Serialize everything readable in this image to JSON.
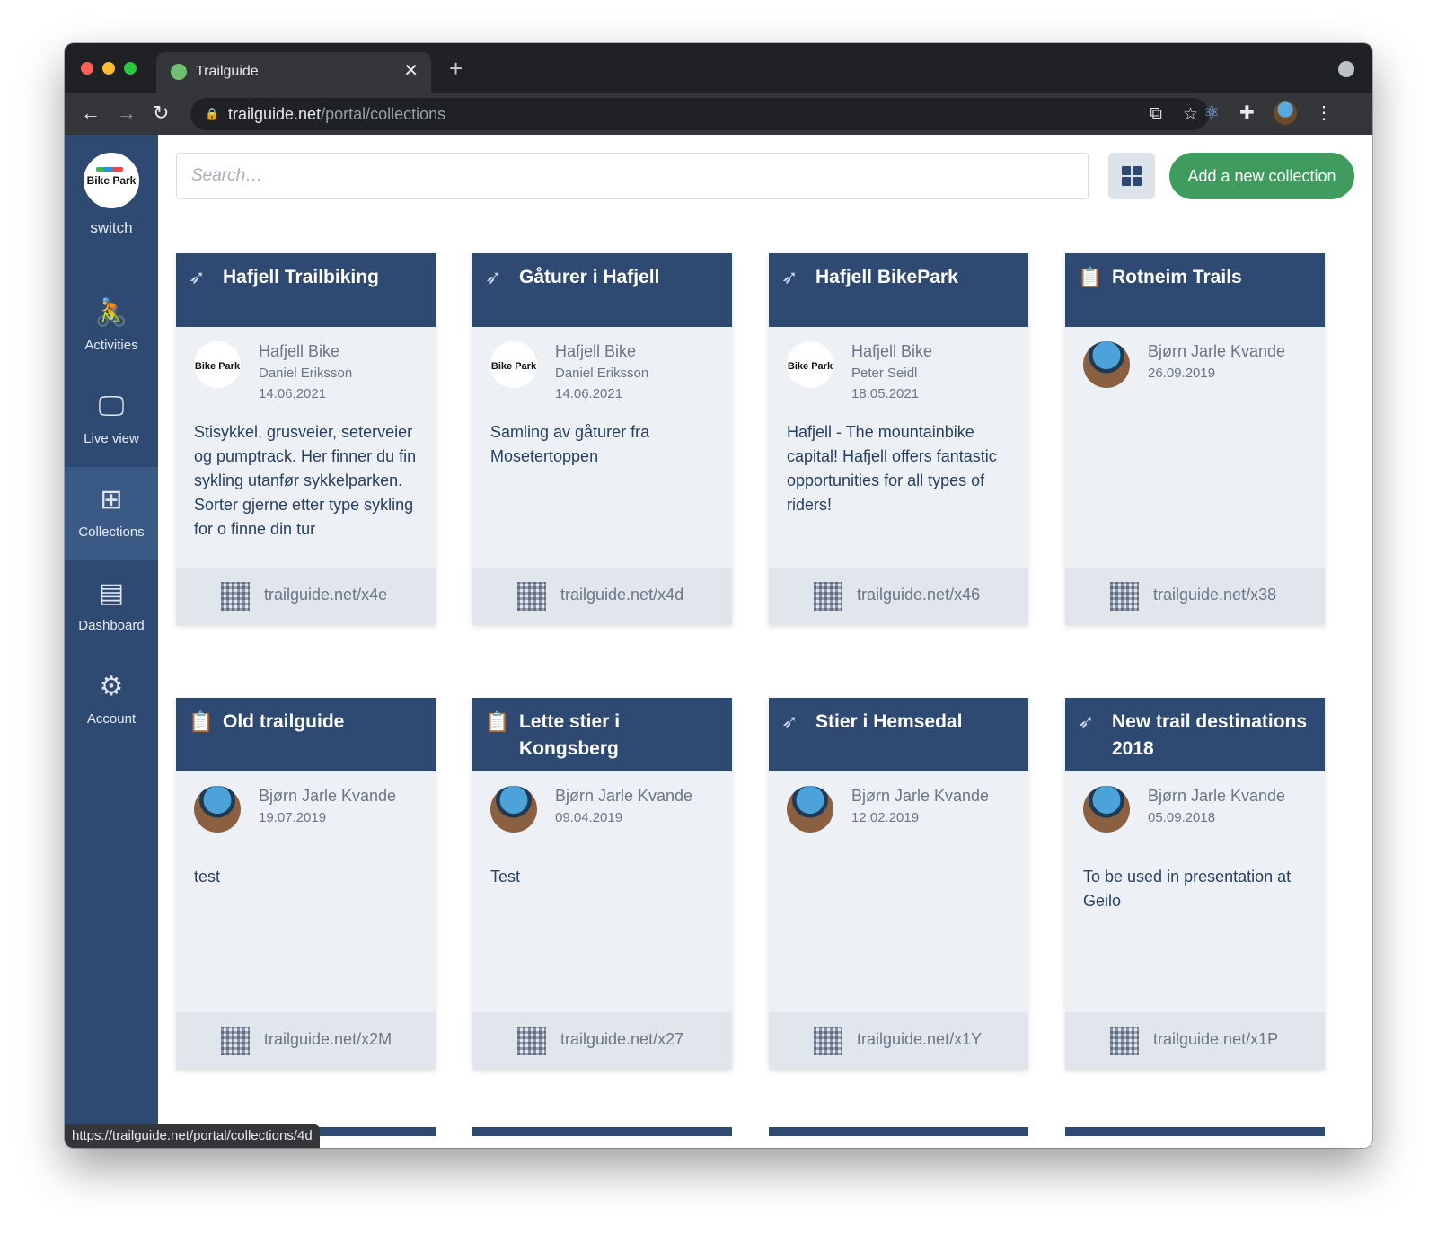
{
  "browser": {
    "tab_title": "Trailguide",
    "url_host": "trailguide.net",
    "url_path": "/portal/collections",
    "status_url": "https://trailguide.net/portal/collections/4d"
  },
  "sidebar": {
    "org_logo_text": "Bike Park",
    "switch_label": "switch",
    "items": [
      {
        "label": "Activities",
        "icon": "cyclist-icon"
      },
      {
        "label": "Live view",
        "icon": "monitor-eye-icon"
      },
      {
        "label": "Collections",
        "icon": "collections-grid-plus-icon",
        "active": true
      },
      {
        "label": "Dashboard",
        "icon": "dashboard-icon"
      },
      {
        "label": "Account",
        "icon": "gear-icon"
      }
    ]
  },
  "toolbar": {
    "search_placeholder": "Search…",
    "add_label": "Add a new collection"
  },
  "cards": [
    {
      "title": "Hafjell Trailbiking",
      "icon": "trail-arrow-icon",
      "avatar": "org",
      "avatar_text": "Bike Park",
      "owner": "Hafjell Bike",
      "author": "Daniel Eriksson",
      "date": "14.06.2021",
      "description": "Stisykkel, grusveier, seterveier og pumptrack. Her finner du fin sykling utanfør sykkelparken. Sorter gjerne etter type sykling for o finne din tur",
      "link": "trailguide.net/x4e"
    },
    {
      "title": "Gåturer i Hafjell",
      "icon": "trail-arrow-icon",
      "avatar": "org",
      "avatar_text": "Bike Park",
      "owner": "Hafjell Bike",
      "author": "Daniel Eriksson",
      "date": "14.06.2021",
      "description": "Samling av gåturer fra Mosetertoppen",
      "link": "trailguide.net/x4d"
    },
    {
      "title": "Hafjell BikePark",
      "icon": "trail-arrow-icon",
      "avatar": "org",
      "avatar_text": "Bike Park",
      "owner": "Hafjell Bike",
      "author": "Peter Seidl",
      "date": "18.05.2021",
      "description": "Hafjell - The mountainbike capital! Hafjell offers fantastic opportunities for all types of riders!",
      "link": "trailguide.net/x46"
    },
    {
      "title": "Rotneim Trails",
      "icon": "clipboard-search-icon",
      "avatar": "person",
      "owner": "Bjørn Jarle Kvande",
      "author": "",
      "date": "26.09.2019",
      "description": "",
      "link": "trailguide.net/x38"
    },
    {
      "title": "Old trailguide",
      "icon": "clipboard-search-icon",
      "avatar": "person",
      "owner": "Bjørn Jarle Kvande",
      "author": "",
      "date": "19.07.2019",
      "description": "test",
      "link": "trailguide.net/x2M"
    },
    {
      "title": "Lette stier i Kongsberg",
      "icon": "clipboard-search-icon",
      "avatar": "person",
      "owner": "Bjørn Jarle Kvande",
      "author": "",
      "date": "09.04.2019",
      "description": "Test",
      "link": "trailguide.net/x27"
    },
    {
      "title": "Stier i Hemsedal",
      "icon": "trail-arrow-icon",
      "avatar": "person",
      "owner": "Bjørn Jarle Kvande",
      "author": "",
      "date": "12.02.2019",
      "description": "",
      "link": "trailguide.net/x1Y"
    },
    {
      "title": "New trail destinations 2018",
      "icon": "trail-arrow-icon",
      "avatar": "person",
      "owner": "Bjørn Jarle Kvande",
      "author": "",
      "date": "05.09.2018",
      "description": "To be used in presentation at Geilo",
      "link": "trailguide.net/x1P"
    }
  ]
}
